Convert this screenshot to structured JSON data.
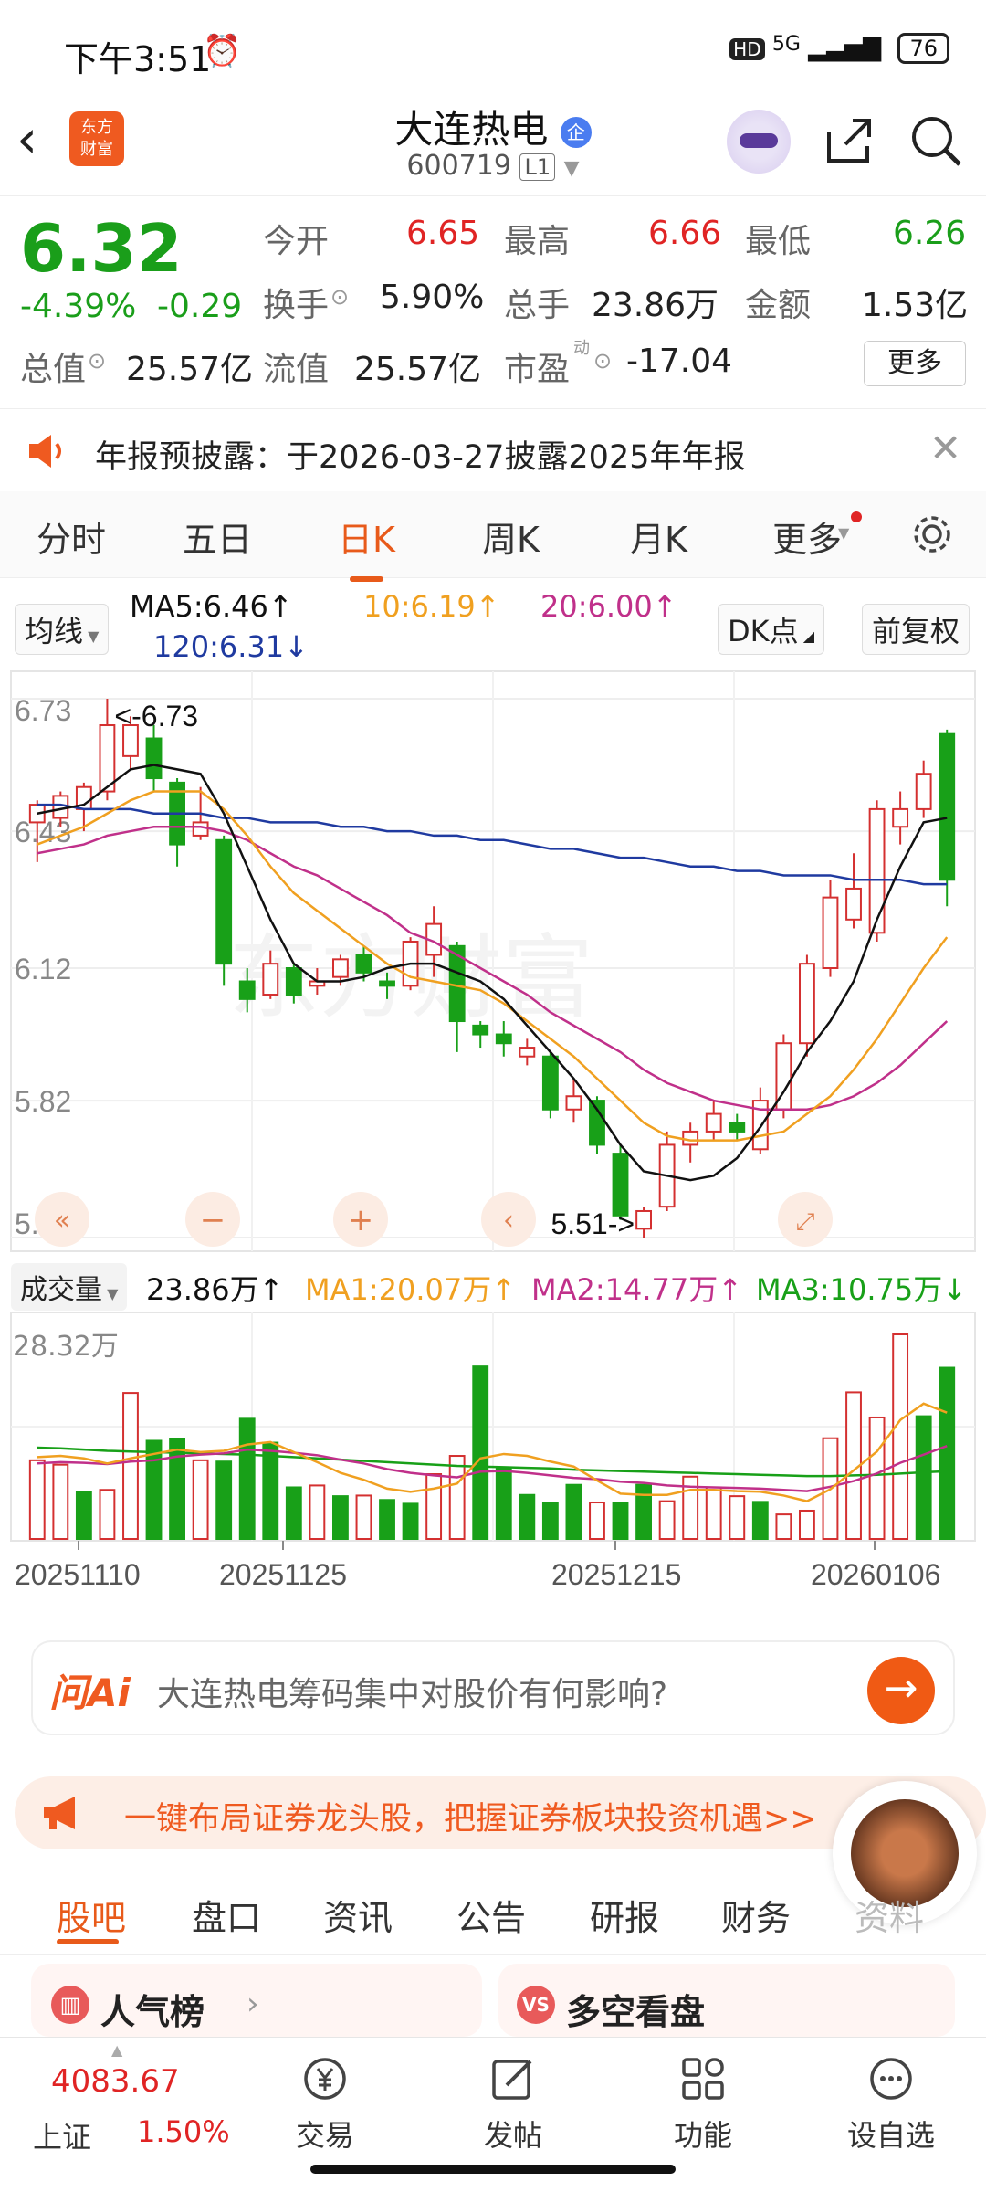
{
  "status_bar": {
    "time": "下午3:51",
    "network": "5G",
    "hd": "HD",
    "battery": "76"
  },
  "header": {
    "title": "大连热电",
    "badge": "企",
    "code": "600719",
    "level": "L1",
    "logo_text": "东方财富"
  },
  "quote": {
    "price": "6.32",
    "change_pct": "-4.39%",
    "change": "-0.29",
    "open_label": "今开",
    "open": "6.65",
    "high_label": "最高",
    "high": "6.66",
    "low_label": "最低",
    "low": "6.26",
    "turnover_label": "换手",
    "turnover": "5.90%",
    "volume_label": "总手",
    "volume": "23.86万",
    "amount_label": "金额",
    "amount": "1.53亿",
    "mktcap_label": "总值",
    "mktcap": "25.57亿",
    "float_label": "流值",
    "float": "25.57亿",
    "pe_label": "市盈",
    "pe_sup": "动",
    "pe": "-17.04",
    "more_label": "更多"
  },
  "notice": {
    "text": "年报预披露：于2026-03-27披露2025年年报"
  },
  "k_tabs": [
    "分时",
    "五日",
    "日K",
    "周K",
    "月K",
    "更多"
  ],
  "k_active": 2,
  "ma_legend": {
    "type_btn": "均线",
    "ma5": "MA5:6.46↑",
    "ma10": "10:6.19↑",
    "ma20": "20:6.00↑",
    "ma120": "120:6.31↓",
    "dk_btn": "DK点",
    "adjust_btn": "前复权"
  },
  "colors": {
    "ma5": "#111111",
    "ma10": "#f0a020",
    "ma20": "#c0308a",
    "ma120": "#1f3aa0",
    "up": "#d43030",
    "down": "#18a018",
    "accent": "#e85a1a"
  },
  "chart_data": [
    {
      "type": "candlestick",
      "y_ticks": [
        "6.73",
        "6.43",
        "6.12",
        "5.82",
        "5.51"
      ],
      "ylim": [
        5.51,
        6.73
      ],
      "x_ticks": [
        "20251110",
        "20251125",
        "20251215",
        "20260106"
      ],
      "annotations": {
        "high": "<-6.73",
        "low": "5.51->"
      },
      "candles": [
        {
          "o": 6.45,
          "c": 6.49,
          "h": 6.5,
          "l": 6.36
        },
        {
          "o": 6.46,
          "c": 6.51,
          "h": 6.52,
          "l": 6.44
        },
        {
          "o": 6.48,
          "c": 6.53,
          "h": 6.54,
          "l": 6.43
        },
        {
          "o": 6.52,
          "c": 6.67,
          "h": 6.73,
          "l": 6.5
        },
        {
          "o": 6.6,
          "c": 6.67,
          "h": 6.69,
          "l": 6.57
        },
        {
          "o": 6.64,
          "c": 6.55,
          "h": 6.67,
          "l": 6.52
        },
        {
          "o": 6.54,
          "c": 6.4,
          "h": 6.55,
          "l": 6.35
        },
        {
          "o": 6.42,
          "c": 6.45,
          "h": 6.53,
          "l": 6.41
        },
        {
          "o": 6.41,
          "c": 6.13,
          "h": 6.42,
          "l": 6.08
        },
        {
          "o": 6.09,
          "c": 6.05,
          "h": 6.12,
          "l": 6.02
        },
        {
          "o": 6.06,
          "c": 6.13,
          "h": 6.16,
          "l": 6.05
        },
        {
          "o": 6.12,
          "c": 6.06,
          "h": 6.13,
          "l": 6.04
        },
        {
          "o": 6.08,
          "c": 6.09,
          "h": 6.12,
          "l": 6.06
        },
        {
          "o": 6.1,
          "c": 6.14,
          "h": 6.15,
          "l": 6.08
        },
        {
          "o": 6.15,
          "c": 6.11,
          "h": 6.17,
          "l": 6.09
        },
        {
          "o": 6.09,
          "c": 6.08,
          "h": 6.11,
          "l": 6.05
        },
        {
          "o": 6.08,
          "c": 6.18,
          "h": 6.19,
          "l": 6.07
        },
        {
          "o": 6.15,
          "c": 6.22,
          "h": 6.26,
          "l": 6.1
        },
        {
          "o": 6.17,
          "c": 6.0,
          "h": 6.18,
          "l": 5.93
        },
        {
          "o": 5.99,
          "c": 5.97,
          "h": 6.0,
          "l": 5.94
        },
        {
          "o": 5.97,
          "c": 5.95,
          "h": 6.0,
          "l": 5.92
        },
        {
          "o": 5.92,
          "c": 5.94,
          "h": 5.96,
          "l": 5.9
        },
        {
          "o": 5.92,
          "c": 5.8,
          "h": 5.93,
          "l": 5.78
        },
        {
          "o": 5.8,
          "c": 5.83,
          "h": 5.87,
          "l": 5.77
        },
        {
          "o": 5.82,
          "c": 5.72,
          "h": 5.83,
          "l": 5.7
        },
        {
          "o": 5.7,
          "c": 5.56,
          "h": 5.72,
          "l": 5.55
        },
        {
          "o": 5.53,
          "c": 5.57,
          "h": 5.58,
          "l": 5.51
        },
        {
          "o": 5.58,
          "c": 5.72,
          "h": 5.75,
          "l": 5.57
        },
        {
          "o": 5.72,
          "c": 5.75,
          "h": 5.77,
          "l": 5.68
        },
        {
          "o": 5.75,
          "c": 5.79,
          "h": 5.82,
          "l": 5.73
        },
        {
          "o": 5.77,
          "c": 5.75,
          "h": 5.79,
          "l": 5.73
        },
        {
          "o": 5.71,
          "c": 5.82,
          "h": 5.85,
          "l": 5.7
        },
        {
          "o": 5.8,
          "c": 5.95,
          "h": 5.97,
          "l": 5.78
        },
        {
          "o": 5.95,
          "c": 6.13,
          "h": 6.15,
          "l": 5.92
        },
        {
          "o": 6.12,
          "c": 6.28,
          "h": 6.32,
          "l": 6.1
        },
        {
          "o": 6.23,
          "c": 6.3,
          "h": 6.38,
          "l": 6.21
        },
        {
          "o": 6.2,
          "c": 6.48,
          "h": 6.5,
          "l": 6.18
        },
        {
          "o": 6.44,
          "c": 6.48,
          "h": 6.52,
          "l": 6.4
        },
        {
          "o": 6.48,
          "c": 6.56,
          "h": 6.59,
          "l": 6.46
        },
        {
          "o": 6.65,
          "c": 6.32,
          "h": 6.66,
          "l": 6.26
        }
      ],
      "ma5": [
        6.47,
        6.48,
        6.49,
        6.53,
        6.57,
        6.58,
        6.57,
        6.56,
        6.47,
        6.35,
        6.23,
        6.13,
        6.09,
        6.09,
        6.1,
        6.12,
        6.13,
        6.13,
        6.11,
        6.09,
        6.05,
        5.99,
        5.93,
        5.87,
        5.8,
        5.72,
        5.66,
        5.65,
        5.64,
        5.65,
        5.69,
        5.76,
        5.84,
        5.93,
        6.0,
        6.09,
        6.23,
        6.35,
        6.45,
        6.46
      ],
      "ma10": [
        6.4,
        6.42,
        6.44,
        6.47,
        6.5,
        6.52,
        6.52,
        6.52,
        6.48,
        6.42,
        6.35,
        6.29,
        6.25,
        6.21,
        6.17,
        6.13,
        6.1,
        6.09,
        6.08,
        6.07,
        6.04,
        6.0,
        5.96,
        5.92,
        5.87,
        5.82,
        5.77,
        5.74,
        5.73,
        5.73,
        5.73,
        5.74,
        5.75,
        5.79,
        5.83,
        5.89,
        5.96,
        6.04,
        6.12,
        6.19
      ],
      "ma20": [
        6.38,
        6.39,
        6.4,
        6.42,
        6.43,
        6.44,
        6.44,
        6.44,
        6.43,
        6.41,
        6.38,
        6.35,
        6.33,
        6.3,
        6.27,
        6.24,
        6.2,
        6.18,
        6.15,
        6.12,
        6.09,
        6.06,
        6.02,
        5.99,
        5.96,
        5.93,
        5.89,
        5.86,
        5.84,
        5.82,
        5.81,
        5.8,
        5.8,
        5.8,
        5.81,
        5.83,
        5.86,
        5.9,
        5.95,
        6.0
      ],
      "ma120": [
        6.49,
        6.49,
        6.48,
        6.48,
        6.48,
        6.47,
        6.47,
        6.47,
        6.46,
        6.46,
        6.45,
        6.45,
        6.45,
        6.44,
        6.44,
        6.43,
        6.43,
        6.42,
        6.42,
        6.41,
        6.41,
        6.4,
        6.39,
        6.39,
        6.38,
        6.37,
        6.37,
        6.36,
        6.35,
        6.35,
        6.34,
        6.34,
        6.33,
        6.33,
        6.33,
        6.32,
        6.32,
        6.32,
        6.31,
        6.31
      ]
    },
    {
      "type": "bar",
      "title": "成交量",
      "ymax_label": "28.32万",
      "ylim": [
        0,
        28.32
      ],
      "legend": {
        "vol": "23.86万↑",
        "ma1": "MA1:20.07万↑",
        "ma2": "MA2:14.77万↑",
        "ma3": "MA3:10.75万↓"
      },
      "values": [
        12.5,
        11.8,
        7.5,
        7.8,
        23.2,
        15.6,
        15.9,
        12.5,
        12.3,
        19.1,
        15.3,
        8.2,
        8.5,
        6.8,
        6.9,
        6.2,
        5.6,
        10.3,
        13.2,
        27.4,
        11.3,
        7.0,
        5.8,
        8.6,
        5.8,
        5.8,
        8.6,
        6.0,
        9.9,
        8.2,
        6.8,
        5.9,
        3.9,
        4.5,
        16.0,
        23.3,
        19.3,
        32.5,
        19.5,
        27.2
      ],
      "up": [
        true,
        true,
        false,
        true,
        true,
        false,
        false,
        true,
        false,
        false,
        false,
        false,
        true,
        false,
        true,
        false,
        false,
        true,
        true,
        false,
        false,
        false,
        false,
        false,
        true,
        false,
        false,
        true,
        true,
        true,
        true,
        false,
        true,
        true,
        true,
        true,
        true,
        true,
        false,
        false
      ],
      "ma1_line": [
        13,
        13.2,
        12.8,
        12,
        12.8,
        13.5,
        14.2,
        13.8,
        14,
        15,
        15.4,
        13.8,
        12.2,
        10.5,
        9.4,
        8,
        7.5,
        8,
        8.8,
        12.8,
        13.5,
        13.2,
        12.3,
        11.5,
        9.3,
        7.2,
        7,
        7,
        7.8,
        7.8,
        7.6,
        7.5,
        6.9,
        6,
        7.9,
        10.9,
        13.9,
        18.9,
        21.5,
        20.07
      ],
      "ma2_line": [
        12,
        12.2,
        12.1,
        11.9,
        12.3,
        12.5,
        13.1,
        13.4,
        13.6,
        14.2,
        14,
        13.7,
        13.3,
        12.6,
        12,
        11.1,
        10.5,
        10.1,
        9.8,
        10.7,
        10.8,
        10.5,
        10.1,
        9.7,
        9.5,
        9.1,
        8.9,
        8.5,
        8.3,
        8.2,
        8.1,
        8,
        7.8,
        7.6,
        8.3,
        9.2,
        10.4,
        12.1,
        13.4,
        14.77
      ],
      "ma3_line": [
        14.5,
        14.4,
        14.2,
        14,
        13.9,
        13.8,
        13.7,
        13.6,
        13.5,
        13.4,
        13.2,
        13,
        12.8,
        12.6,
        12.4,
        12.2,
        12,
        11.8,
        11.6,
        11.5,
        11.4,
        11.3,
        11.2,
        11,
        10.9,
        10.8,
        10.7,
        10.6,
        10.5,
        10.4,
        10.3,
        10.2,
        10.1,
        10,
        10,
        10.1,
        10.2,
        10.4,
        10.6,
        10.75
      ]
    }
  ],
  "ai_box": {
    "logo": "问Ai",
    "placeholder": "大连热电筹码集中对股价有何影响?"
  },
  "promo": {
    "text": "一键布局证券龙头股，把握证券板块投资机遇>>"
  },
  "lower_tabs": [
    "股吧",
    "盘口",
    "资讯",
    "公告",
    "研报",
    "财务",
    "资料"
  ],
  "cards": {
    "left": "人气榜",
    "right": "多空看盘"
  },
  "bottom_nav": {
    "index_value": "4083.67",
    "index_name": "上证",
    "index_pct": "1.50%",
    "items": [
      "交易",
      "发帖",
      "功能",
      "设自选"
    ]
  }
}
